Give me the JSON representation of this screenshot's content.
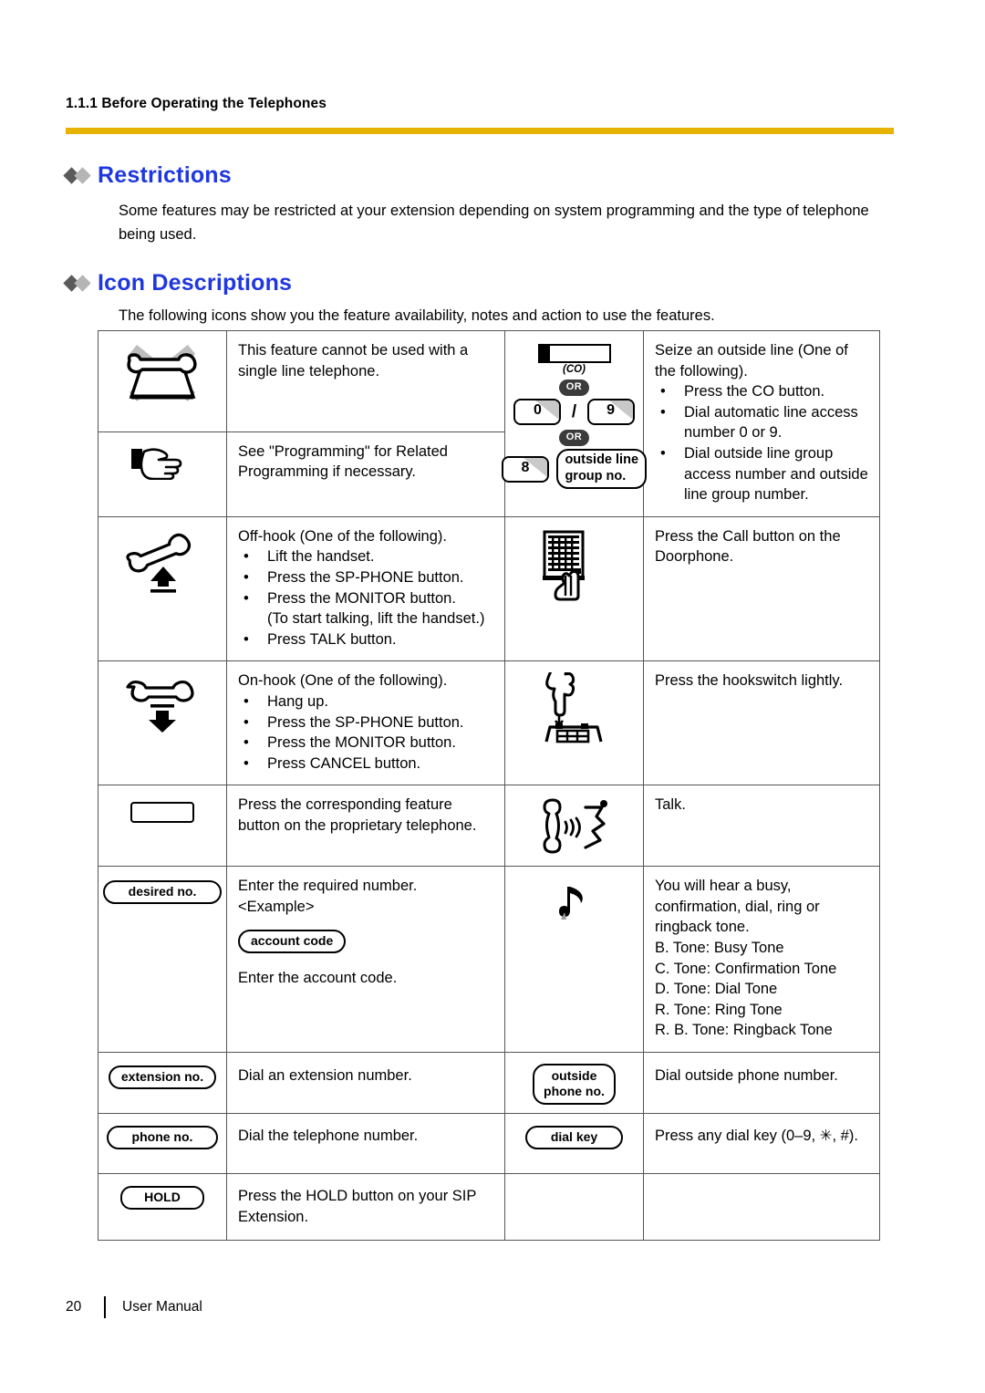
{
  "runhead": "1.1.1 Before Operating the Telephones",
  "sections": {
    "restrictions": {
      "heading": "Restrictions",
      "paragraph": "Some features may be restricted at your extension depending on system programming and the type of telephone being used."
    },
    "icon_descriptions": {
      "heading": "Icon Descriptions",
      "paragraph": "The following icons show you the feature availability, notes and action to use the features."
    }
  },
  "table": {
    "left": {
      "r1": {
        "icon": "crossed-out-telephone-icon",
        "text": "This feature cannot be used with a single line telephone."
      },
      "r2": {
        "icon": "pointing-hand-icon",
        "text": "See \"Programming\" for Related Programming if necessary."
      },
      "r3": {
        "icon": "handset-off-hook-icon",
        "title": "Off-hook (One of the following).",
        "bullets": [
          "Lift the handset.",
          "Press the SP-PHONE button.",
          "Press the MONITOR button.",
          "Press TALK button."
        ],
        "bullet3_continuation": "(To start talking, lift the handset.)"
      },
      "r4": {
        "icon": "handset-on-hook-icon",
        "title": "On-hook (One of the following).",
        "bullets": [
          "Hang up.",
          "Press the SP-PHONE button.",
          "Press the MONITOR button.",
          "Press CANCEL button."
        ]
      },
      "r5": {
        "icon": "feature-button-icon",
        "text": "Press the corresponding feature button on the proprietary telephone."
      },
      "r6": {
        "icon": "desired-no-key-icon",
        "key_label": "desired no.",
        "line1": "Enter the required number.",
        "line2": "<Example>",
        "example_key_label": "account code",
        "line3": "Enter the account code."
      },
      "r7": {
        "key_label": "extension no.",
        "text": "Dial an extension number."
      },
      "r8": {
        "key_label": "phone no.",
        "text": "Dial the telephone number."
      },
      "r9": {
        "key_label": "HOLD",
        "text": "Press the HOLD button on your SIP Extension."
      }
    },
    "right": {
      "r1": {
        "co_button_label": "(CO)",
        "or_label": "OR",
        "key_zero": "0",
        "key_nine": "9",
        "key_eight": "8",
        "group_pill_line1": "outside line",
        "group_pill_line2": "group no.",
        "title": "Seize an outside line (One of the following).",
        "bullets": [
          "Press the CO button.",
          "Dial automatic line access number 0 or 9.",
          "Dial outside line group access number and outside line group number."
        ]
      },
      "r2": {
        "icon": "doorphone-call-button-icon",
        "text": "Press the Call button on the Doorphone."
      },
      "r3": {
        "icon": "hookswitch-press-icon",
        "text": "Press the hookswitch lightly."
      },
      "r4": {
        "icon": "talking-handset-icon",
        "text": "Talk."
      },
      "r5": {
        "icon": "music-note-tone-icon",
        "line1": "You will hear a busy, confirmation, dial, ring or ringback tone.",
        "tones": [
          "B. Tone: Busy Tone",
          "C. Tone: Confirmation Tone",
          "D. Tone: Dial Tone",
          "R. Tone: Ring Tone",
          "R. B. Tone: Ringback Tone"
        ]
      },
      "r6": {
        "key_line1": "outside",
        "key_line2": "phone no.",
        "text": "Dial outside phone number."
      },
      "r7": {
        "key_label": "dial key",
        "text": "Press any dial key (0–9, ✳, #)."
      },
      "r8": {
        "key_label": "",
        "text": ""
      }
    }
  },
  "footer": {
    "page_number": "20",
    "label": "User Manual"
  },
  "colors": {
    "heading_blue": "#1f37e0",
    "rule_gold": "#e6b400",
    "diamond_dark": "#5a5a5a",
    "diamond_light": "#b5b5b5"
  }
}
